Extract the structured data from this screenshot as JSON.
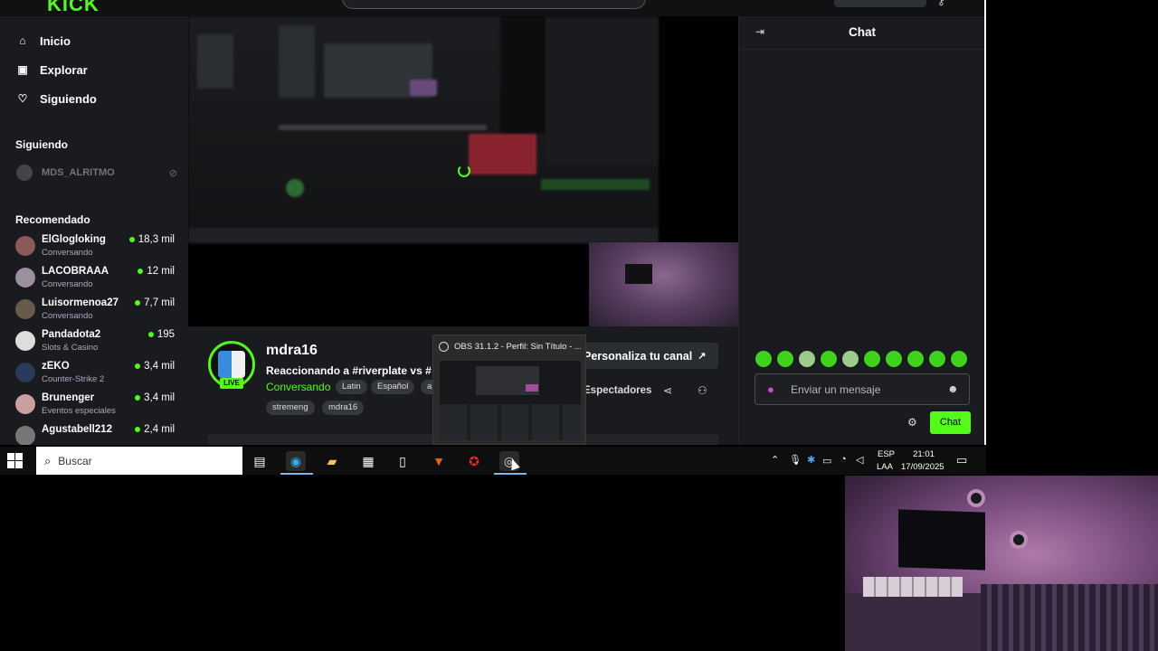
{
  "kick": {
    "logo": "KICK",
    "nav": [
      {
        "label": "Inicio",
        "icon": "home-icon"
      },
      {
        "label": "Explorar",
        "icon": "compass-icon"
      },
      {
        "label": "Siguiendo",
        "icon": "heart-icon"
      }
    ],
    "following_title": "Siguiendo",
    "following": [
      {
        "name": "MDS_ALRITMO"
      }
    ],
    "recommended_title": "Recomendado",
    "recommended": [
      {
        "name": "ElGlogloking",
        "category": "Conversando",
        "viewers": "18,3 mil"
      },
      {
        "name": "LACOBRAAA",
        "category": "Conversando",
        "viewers": "12 mil"
      },
      {
        "name": "Luisormenoa27",
        "category": "Conversando",
        "viewers": "7,7 mil"
      },
      {
        "name": "Pandadota2",
        "category": "Slots & Casino",
        "viewers": "195"
      },
      {
        "name": "zEKO",
        "category": "Counter-Strike 2",
        "viewers": "3,4 mil"
      },
      {
        "name": "Brunenger",
        "category": "Eventos especiales",
        "viewers": "3,4 mil"
      },
      {
        "name": "Agustabell212",
        "category": "",
        "viewers": "2,4 mil"
      }
    ],
    "stream": {
      "channel": "mdra16",
      "title": "Reaccionando a #riverplate vs # p",
      "category": "Conversando",
      "live_label": "LIVE",
      "tags_row1": [
        "Latin",
        "Español",
        "a"
      ],
      "tags_row2": [
        "stremeng",
        "mdra16"
      ],
      "customize_label": "Personaliza tu canal",
      "viewers_label": "Espectadores"
    },
    "chat": {
      "title": "Chat",
      "placeholder": "Enviar un mensaje",
      "send_label": "Chat"
    }
  },
  "thumbnail": {
    "title": "OBS 31.1.2 - Perfil: Sin Título - ..."
  },
  "taskbar": {
    "search_placeholder": "Buscar",
    "lang_top": "ESP",
    "lang_bottom": "LAA",
    "time": "21:01",
    "date": "17/09/2025"
  },
  "colors": {
    "kick_green": "#53fc18",
    "background": "#191b1f",
    "taskbar": "#0e0e0e"
  }
}
